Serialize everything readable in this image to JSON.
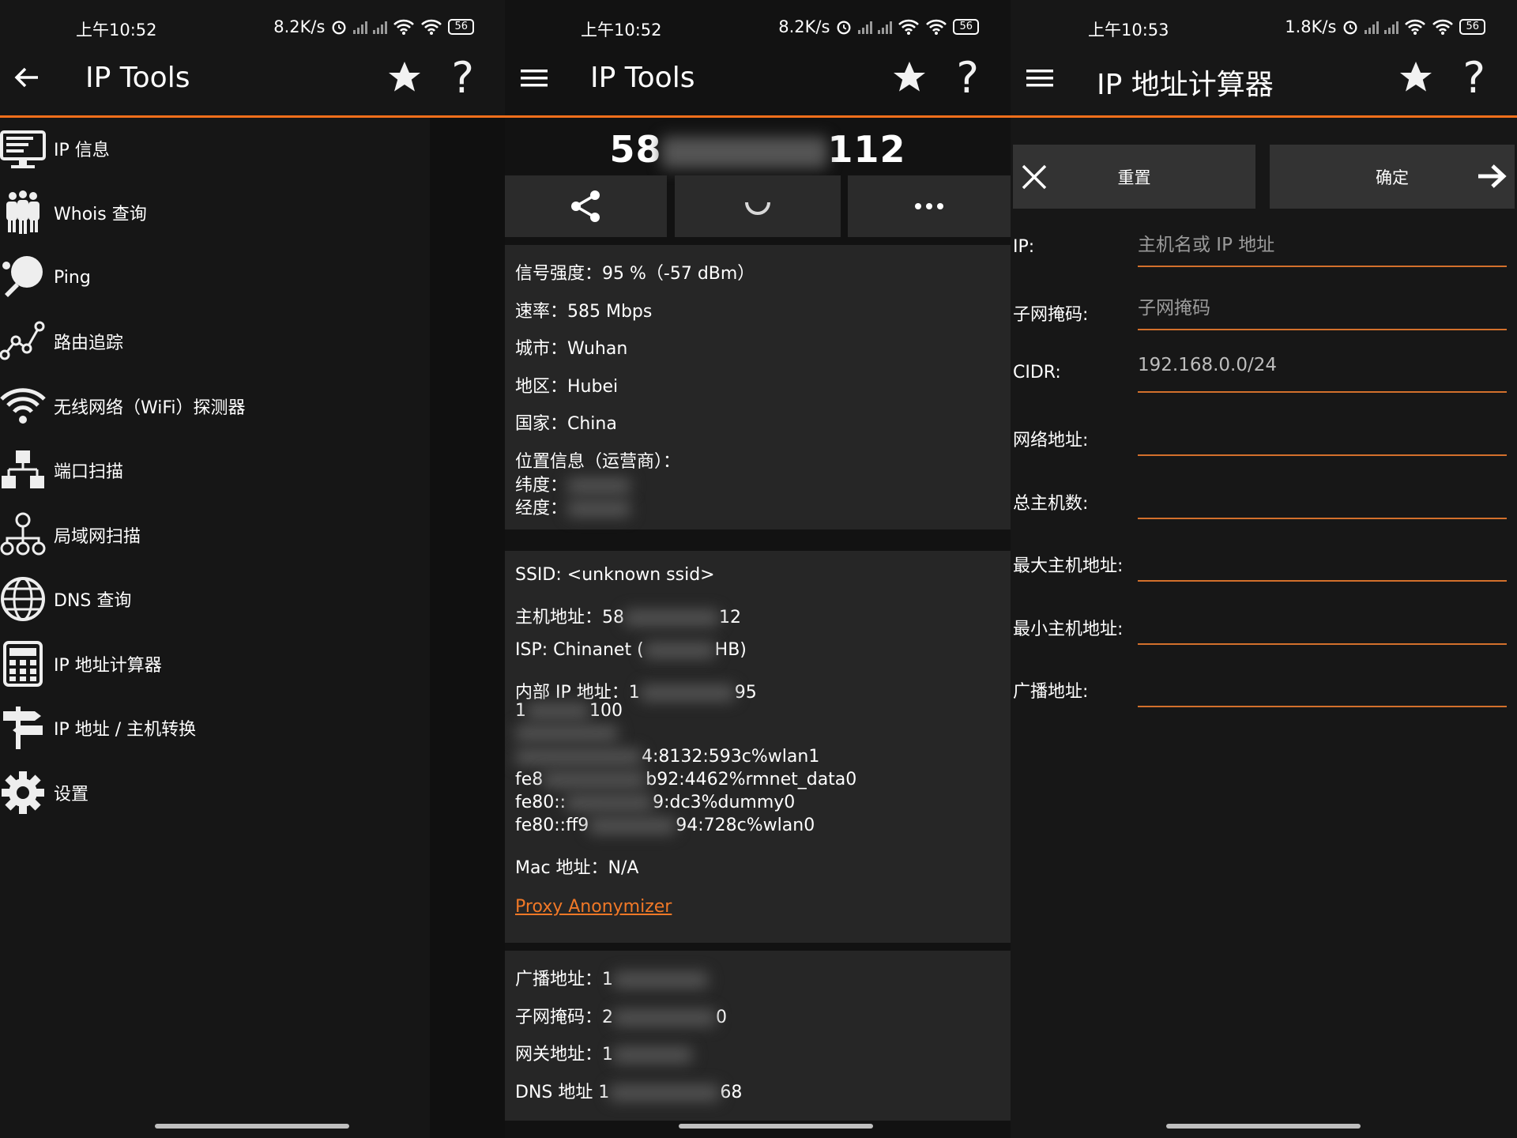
{
  "status": [
    {
      "time": "上午10:52",
      "speed": "8.2K/s",
      "battery": "56"
    },
    {
      "time": "上午10:52",
      "speed": "8.2K/s",
      "battery": "56"
    },
    {
      "time": "上午10:53",
      "speed": "1.8K/s",
      "battery": "56"
    }
  ],
  "panel1": {
    "title": "IP Tools",
    "menu": [
      {
        "label": "IP 信息",
        "icon": "monitor-icon"
      },
      {
        "label": "Whois 查询",
        "icon": "people-icon"
      },
      {
        "label": "Ping",
        "icon": "ping-pong-icon"
      },
      {
        "label": "路由追踪",
        "icon": "route-icon"
      },
      {
        "label": "无线网络（WiFi）探测器",
        "icon": "wifi-icon"
      },
      {
        "label": "端口扫描",
        "icon": "network-icon"
      },
      {
        "label": "局域网扫描",
        "icon": "lan-icon"
      },
      {
        "label": "DNS 查询",
        "icon": "globe-icon"
      },
      {
        "label": "IP 地址计算器",
        "icon": "calculator-icon"
      },
      {
        "label": "IP 地址 / 主机转换",
        "icon": "signpost-icon"
      },
      {
        "label": "设置",
        "icon": "gear-icon"
      }
    ]
  },
  "panel2": {
    "title": "IP Tools",
    "ip_prefix": "58",
    "ip_suffix": "112",
    "wifi_card": {
      "signal": "信号强度：95 %（-57 dBm）",
      "rate": "速率：585 Mbps",
      "city": "城市：Wuhan",
      "region": "地区：Hubei",
      "country": "国家：China",
      "location": "位置信息（运营商）：",
      "lat": "纬度：",
      "lon": "经度："
    },
    "net_card": {
      "ssid": "SSID: <unknown ssid>",
      "host": "主机地址：58",
      "host_tail": "12",
      "isp_a": "ISP: Chinanet (",
      "isp_b": "HB)",
      "inner": "内部 IP 地址：1",
      "inner_tail": "95",
      "line2_a": "1",
      "line2_b": "100",
      "v6a": "4:8132:593c%wlan1",
      "v6b_a": "fe8",
      "v6b": "b92:4462%rmnet_data0",
      "v6c_a": "fe80::",
      "v6c": "9:dc3%dummy0",
      "v6d_a": "fe80::ff9",
      "v6d": "94:728c%wlan0",
      "mac": "Mac 地址：N/A",
      "proxy": "Proxy Anonymizer"
    },
    "dhcp_card": {
      "broadcast": "广播地址：1",
      "mask": "子网掩码：2",
      "mask_tail": "0",
      "gateway": "网关地址：1",
      "dns": "DNS 地址 1",
      "dns_tail": "68"
    }
  },
  "panel3": {
    "title": "IP 地址计算器",
    "reset": "重置",
    "ok": "确定",
    "fields": [
      {
        "label": "IP:",
        "placeholder": "主机名或 IP 地址",
        "value": ""
      },
      {
        "label": "子网掩码:",
        "placeholder": "子网掩码",
        "value": ""
      },
      {
        "label": "CIDR:",
        "placeholder": "",
        "value": "192.168.0.0/24"
      },
      {
        "label": "网络地址:",
        "placeholder": "",
        "value": ""
      },
      {
        "label": "总主机数:",
        "placeholder": "",
        "value": ""
      },
      {
        "label": "最大主机地址:",
        "placeholder": "",
        "value": ""
      },
      {
        "label": "最小主机地址:",
        "placeholder": "",
        "value": ""
      },
      {
        "label": "广播地址:",
        "placeholder": "",
        "value": ""
      }
    ]
  },
  "colors": {
    "accent": "#f36f1b",
    "link": "#f07827"
  }
}
